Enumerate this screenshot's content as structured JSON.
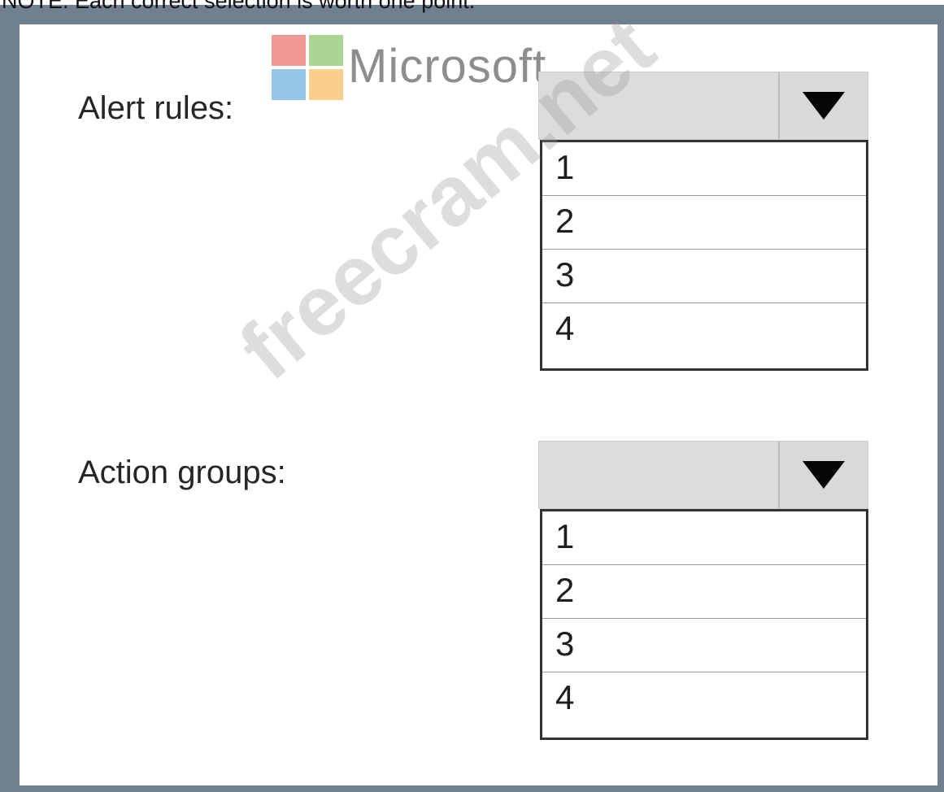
{
  "note": "NOTE: Each correct selection is worth one point.",
  "brand": {
    "name": "Microsoft",
    "logo_colors": [
      "#f25022",
      "#7fba00",
      "#00a4ef",
      "#ffb900"
    ]
  },
  "watermark": "freecram.net",
  "fields": [
    {
      "label": "Alert rules:",
      "selected": "",
      "options": [
        "1",
        "2",
        "3",
        "4"
      ]
    },
    {
      "label": "Action groups:",
      "selected": "",
      "options": [
        "1",
        "2",
        "3",
        "4"
      ]
    }
  ]
}
